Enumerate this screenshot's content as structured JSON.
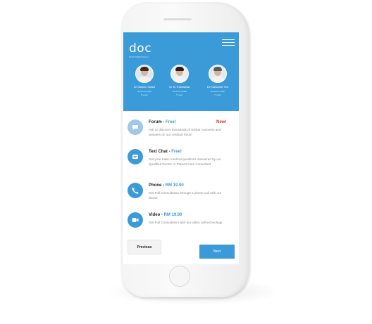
{
  "app": {
    "logo_text": "doc",
    "logo_subtext": "DOCTORONCALL"
  },
  "doctors": [
    {
      "name": "Dr Sachiin Swani",
      "role": "General Health",
      "experience": "8 years"
    },
    {
      "name": "Dr M Thanisthan",
      "role": "General Health",
      "experience": "5 years"
    },
    {
      "name": "Dr Katharine Yeo",
      "role": "General Health",
      "experience": "7 years"
    }
  ],
  "options": [
    {
      "title": "Forum",
      "separator": " - ",
      "price": "Free!",
      "badge": "New!",
      "icon": "forum-chat-icon",
      "description": "Ask or discover thousands of similar concerns and answers on our medical forum"
    },
    {
      "title": "Text Chat",
      "separator": " - ",
      "price": "Free!",
      "icon": "text-chat-icon",
      "description": "Get your basic medical questions answered by our Qualified Doctor or Patient Care Consultant"
    },
    {
      "title": "Phone",
      "separator": " - ",
      "price": "RM 19.90",
      "icon": "phone-icon",
      "description": "Get Full Consultation through a phone call with our doctor"
    },
    {
      "title": "Video",
      "separator": " - ",
      "price": "RM 19.90",
      "icon": "video-icon",
      "description": "Get Full Consultation with our video call technology"
    }
  ],
  "buttons": {
    "previous": "Previous",
    "next": "Next"
  },
  "colors": {
    "accent": "#3a9bd8",
    "badge": "#d9342b"
  }
}
